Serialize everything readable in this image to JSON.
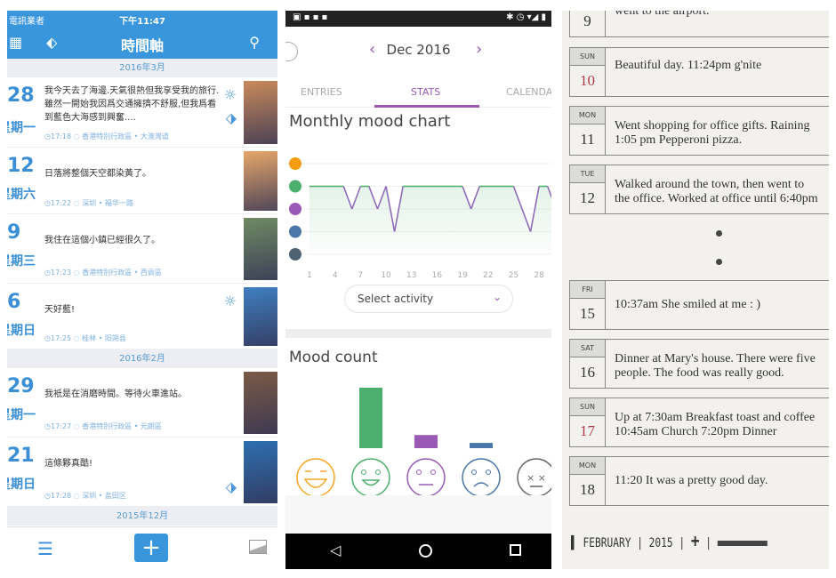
{
  "left": {
    "status": {
      "carrier": "電訊業者",
      "time": "下午11:47"
    },
    "nav": {
      "title": "時間軸",
      "icons": [
        "calendar-icon",
        "tag-icon",
        "search-icon"
      ]
    },
    "sections": [
      {
        "header": "2016年3月",
        "rows": [
          {
            "day": "28",
            "weekday": "星期一",
            "text": "我今天去了海邊.天氣很熱但我享受我的旅行.雖然一開始我因爲交通擁擠不舒服,但我爲看到藍色大海感到興奮....",
            "time": "17:18",
            "location": "香港特別行政區 • 大澳灣道",
            "sun": true,
            "tag": true,
            "photo": "#c98a5a"
          },
          {
            "day": "12",
            "weekday": "星期六",
            "text": "日落將整個天空都染黃了。",
            "time": "17:22",
            "location": "深圳 • 福华一路",
            "photo": "#e6a66a"
          },
          {
            "day": "9",
            "weekday": "星期三",
            "text": "我住在這個小鎮已經很久了。",
            "time": "17:23",
            "location": "香港特別行政區 • 西貢區",
            "photo": "#6f8a63"
          },
          {
            "day": "6",
            "weekday": "星期日",
            "text": "天好藍!",
            "time": "17:25",
            "location": "桂林 • 阳朔县",
            "sun": true,
            "photo": "#3f7fc0"
          }
        ]
      },
      {
        "header": "2016年2月",
        "rows": [
          {
            "day": "29",
            "weekday": "星期一",
            "text": "我衹是在消磨時間。等待火車進站。",
            "time": "17:27",
            "location": "香港特別行政區 • 元朗區",
            "photo": "#7a5a45"
          },
          {
            "day": "21",
            "weekday": "星期日",
            "text": "這條夥真酷!",
            "time": "17:28",
            "location": "深圳 • 盐田区",
            "tag": true,
            "photo": "#2d6fb0"
          }
        ]
      },
      {
        "header": "2015年12月",
        "rows": []
      }
    ],
    "bottom": {
      "icons": [
        "menu-icon",
        "add-icon",
        "image-icon"
      ]
    }
  },
  "mid": {
    "month": "Dec 2016",
    "tabs": [
      "ENTRIES",
      "STATS",
      "CALENDA"
    ],
    "active_tab": "STATS",
    "accent": "#9b59b6",
    "chart_title": "Monthly mood chart",
    "select_activity": "Select activity",
    "count_title": "Mood count"
  },
  "chart_data": [
    {
      "type": "line",
      "title": "Monthly mood chart",
      "x_ticks": [
        1,
        4,
        7,
        10,
        13,
        16,
        19,
        22,
        25,
        28
      ],
      "y_levels": [
        "rad",
        "good",
        "meh",
        "bad",
        "awful"
      ],
      "level_colors": [
        "#f39c12",
        "#4caf6d",
        "#9b59b6",
        "#4a76a8",
        "#4f6272"
      ],
      "x": [
        1,
        2,
        3,
        4,
        5,
        6,
        7,
        8,
        9,
        10,
        11,
        12,
        13,
        14,
        15,
        16,
        17,
        18,
        19,
        20,
        21,
        22,
        23,
        24,
        25,
        26,
        27,
        28,
        29,
        30
      ],
      "values": [
        4,
        4,
        4,
        4,
        4,
        3,
        4,
        4,
        3,
        4,
        2,
        4,
        4,
        4,
        4,
        4,
        4,
        4,
        4,
        3,
        4,
        4,
        4,
        4,
        4,
        3,
        2,
        4,
        4,
        3
      ],
      "ylim": [
        1,
        5
      ]
    },
    {
      "type": "bar",
      "title": "Mood count",
      "categories": [
        "rad",
        "good",
        "meh",
        "bad",
        "awful"
      ],
      "values": [
        0,
        23,
        5,
        2,
        0
      ],
      "colors": [
        "#f5a623",
        "#4caf6d",
        "#9b59b6",
        "#4a76a8",
        "#666666"
      ]
    }
  ],
  "right": {
    "entries": [
      {
        "weekday": "",
        "day": "9",
        "lines": [
          "went to the airport."
        ]
      },
      {
        "weekday": "SUN",
        "day": "10",
        "red": true,
        "lines": [
          "Beautiful day. 11:24pm g'nite"
        ]
      },
      {
        "weekday": "MON",
        "day": "11",
        "lines": [
          "Went shopping for office gifts. Raining",
          "1:05 pm Pepperoni pizza."
        ]
      },
      {
        "weekday": "TUE",
        "day": "12",
        "lines": [
          "Walked around the town, then went to",
          "the office. Worked at office until 6:40pm"
        ]
      },
      {
        "weekday": "FRI",
        "day": "15",
        "lines": [
          "10:37am She smiled at me : )"
        ]
      },
      {
        "weekday": "SAT",
        "day": "16",
        "lines": [
          "Dinner at Mary's house. There were five",
          "people. The food was really good."
        ]
      },
      {
        "weekday": "SUN",
        "day": "17",
        "red": true,
        "lines": [
          "Up at 7:30am Breakfast toast and coffee",
          "10:45am Church   7:20pm Dinner"
        ]
      },
      {
        "weekday": "MON",
        "day": "18",
        "lines": [
          "11:20 It was a pretty good day."
        ]
      }
    ],
    "footer": {
      "month": "FEBRUARY",
      "year": "2015",
      "add": "+"
    }
  }
}
